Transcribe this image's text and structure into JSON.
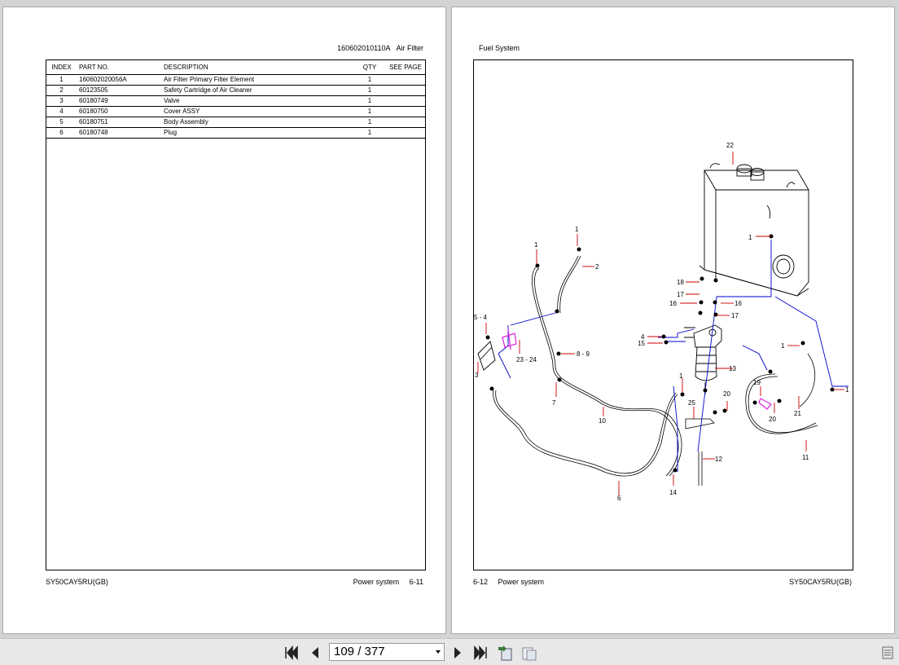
{
  "left_page": {
    "header": {
      "code": "160602010110A",
      "title": "Air Filter"
    },
    "table": {
      "columns": [
        "INDEX",
        "PART NO.",
        "DESCRIPTION",
        "QTY",
        "SEE PAGE"
      ],
      "rows": [
        {
          "index": "1",
          "part_no": "160602020056A",
          "description": "Air Filter Primary Filter Element",
          "qty": "1",
          "see_page": ""
        },
        {
          "index": "2",
          "part_no": "60123505",
          "description": "Safety Cartridge of Air Cleaner",
          "qty": "1",
          "see_page": ""
        },
        {
          "index": "3",
          "part_no": "60180749",
          "description": "Valve",
          "qty": "1",
          "see_page": ""
        },
        {
          "index": "4",
          "part_no": "60180750",
          "description": "Cover ASSY",
          "qty": "1",
          "see_page": ""
        },
        {
          "index": "5",
          "part_no": "60180751",
          "description": "Body Assembly",
          "qty": "1",
          "see_page": ""
        },
        {
          "index": "6",
          "part_no": "60180748",
          "description": "Plug",
          "qty": "1",
          "see_page": ""
        }
      ]
    },
    "footer": {
      "model": "SY50CAY5RU(GB)",
      "section": "Power system",
      "page": "6-11"
    }
  },
  "right_page": {
    "header": {
      "title": "Fuel System"
    },
    "diagram_labels": [
      "22",
      "1",
      "1",
      "1",
      "2",
      "18",
      "17",
      "16",
      "16",
      "17",
      "5 - 4",
      "4",
      "15",
      "8 - 9",
      "13",
      "23 - 24",
      "3",
      "7",
      "1",
      "25",
      "10",
      "19",
      "20",
      "20",
      "21",
      "1",
      "1",
      "12",
      "11",
      "6",
      "14"
    ],
    "footer": {
      "page": "6-12",
      "section": "Power system",
      "model": "SY50CAY5RU(GB)"
    }
  },
  "toolbar": {
    "current_page": "109",
    "total_pages": "377",
    "page_display": "109 / 377",
    "icons": [
      "first-page-icon",
      "previous-page-icon",
      "next-page-icon",
      "last-page-icon",
      "fit-page-icon",
      "fit-width-icon",
      "menu-icon"
    ]
  },
  "colors": {
    "background": "#d4d4d4",
    "page": "#ffffff",
    "callout": "#cc0000",
    "fuel_line": "#0000cc",
    "valve": "#e020e0"
  }
}
